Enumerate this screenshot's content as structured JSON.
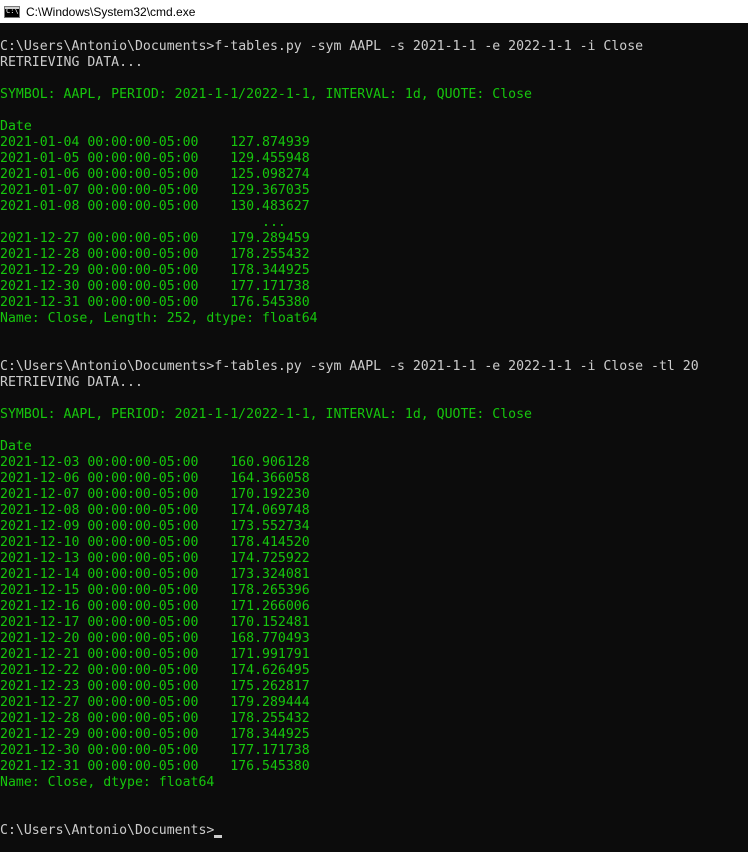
{
  "window": {
    "title": "C:\\Windows\\System32\\cmd.exe",
    "icon": "cmd-icon"
  },
  "colors": {
    "background": "#0c0c0c",
    "text": "#cccccc",
    "output": "#16c60c"
  },
  "console": {
    "prompt": "C:\\Users\\Antonio\\Documents>",
    "runs": [
      {
        "command": "f-tables.py -sym AAPL -s 2021-1-1 -e 2022-1-1 -i Close",
        "status": "RETRIEVING DATA...",
        "header": "SYMBOL: AAPL, PERIOD: 2021-1-1/2022-1-1, INTERVAL: 1d, QUOTE: Close",
        "index_name": "Date",
        "rows": [
          "2021-01-04 00:00:00-05:00    127.874939",
          "2021-01-05 00:00:00-05:00    129.455948",
          "2021-01-06 00:00:00-05:00    125.098274",
          "2021-01-07 00:00:00-05:00    129.367035",
          "2021-01-08 00:00:00-05:00    130.483627",
          "                                 ...",
          "2021-12-27 00:00:00-05:00    179.289459",
          "2021-12-28 00:00:00-05:00    178.255432",
          "2021-12-29 00:00:00-05:00    178.344925",
          "2021-12-30 00:00:00-05:00    177.171738",
          "2021-12-31 00:00:00-05:00    176.545380"
        ],
        "footer": "Name: Close, Length: 252, dtype: float64"
      },
      {
        "command": "f-tables.py -sym AAPL -s 2021-1-1 -e 2022-1-1 -i Close -tl 20",
        "status": "RETRIEVING DATA...",
        "header": "SYMBOL: AAPL, PERIOD: 2021-1-1/2022-1-1, INTERVAL: 1d, QUOTE: Close",
        "index_name": "Date",
        "rows": [
          "2021-12-03 00:00:00-05:00    160.906128",
          "2021-12-06 00:00:00-05:00    164.366058",
          "2021-12-07 00:00:00-05:00    170.192230",
          "2021-12-08 00:00:00-05:00    174.069748",
          "2021-12-09 00:00:00-05:00    173.552734",
          "2021-12-10 00:00:00-05:00    178.414520",
          "2021-12-13 00:00:00-05:00    174.725922",
          "2021-12-14 00:00:00-05:00    173.324081",
          "2021-12-15 00:00:00-05:00    178.265396",
          "2021-12-16 00:00:00-05:00    171.266006",
          "2021-12-17 00:00:00-05:00    170.152481",
          "2021-12-20 00:00:00-05:00    168.770493",
          "2021-12-21 00:00:00-05:00    171.991791",
          "2021-12-22 00:00:00-05:00    174.626495",
          "2021-12-23 00:00:00-05:00    175.262817",
          "2021-12-27 00:00:00-05:00    179.289444",
          "2021-12-28 00:00:00-05:00    178.255432",
          "2021-12-29 00:00:00-05:00    178.344925",
          "2021-12-30 00:00:00-05:00    177.171738",
          "2021-12-31 00:00:00-05:00    176.545380"
        ],
        "footer": "Name: Close, dtype: float64"
      }
    ]
  }
}
